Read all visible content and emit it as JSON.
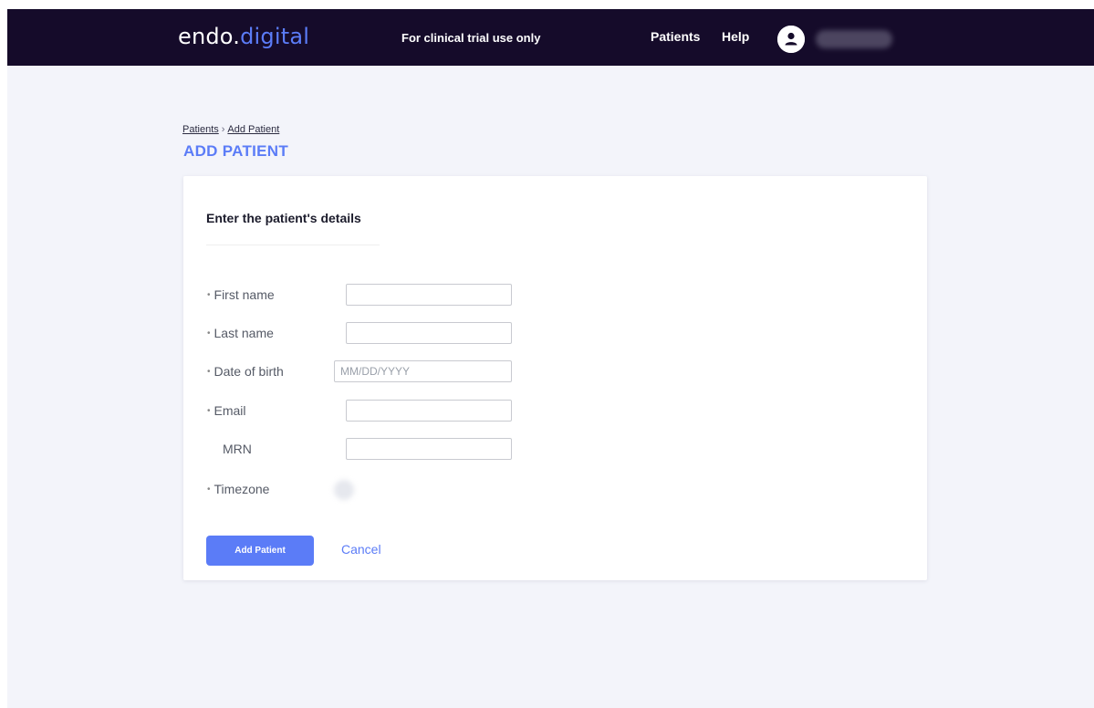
{
  "header": {
    "logo_text": "endo.",
    "logo_accent": "digital",
    "trial_note": "For clinical trial use only",
    "nav": {
      "patients": "Patients",
      "help": "Help"
    },
    "user_icon": "user-avatar-icon"
  },
  "breadcrumb": {
    "parent": "Patients",
    "separator": "›",
    "current": "Add Patient"
  },
  "page_title": "ADD PATIENT",
  "form": {
    "title": "Enter the patient's details",
    "required_marker": "•",
    "fields": [
      {
        "label": "First name",
        "required": true,
        "value": "",
        "placeholder": ""
      },
      {
        "label": "Last name",
        "required": true,
        "value": "",
        "placeholder": ""
      },
      {
        "label": "Date of birth",
        "required": true,
        "value": "",
        "placeholder": "MM/DD/YYYY"
      },
      {
        "label": "Email",
        "required": true,
        "value": "",
        "placeholder": ""
      },
      {
        "label": "MRN",
        "required": false,
        "value": "",
        "placeholder": ""
      },
      {
        "label": "Timezone",
        "required": true,
        "value": ""
      }
    ],
    "submit_label": "Add Patient",
    "cancel_label": "Cancel"
  },
  "colors": {
    "topbar": "#150b2a",
    "accent": "#5b7cf7",
    "background": "#f3f4fa"
  }
}
